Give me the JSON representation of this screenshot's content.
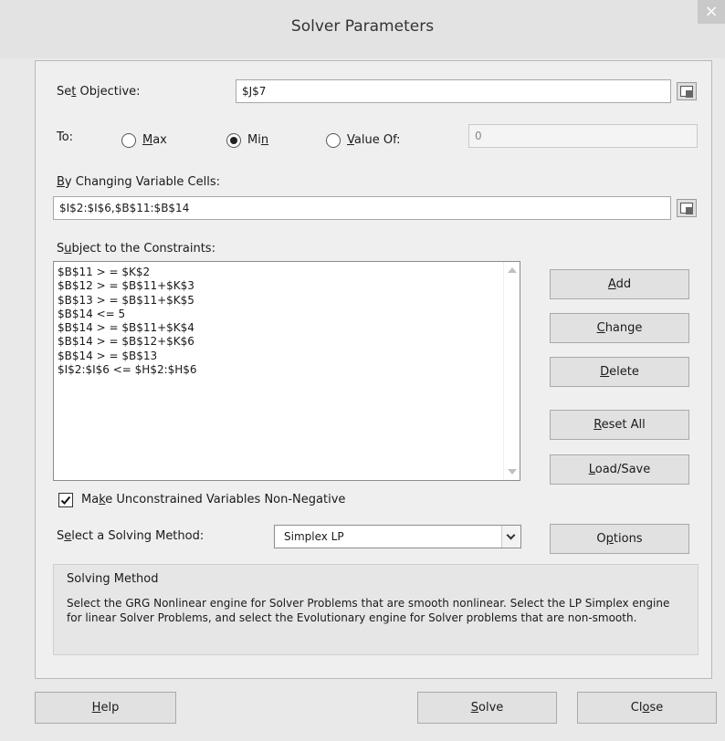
{
  "window": {
    "title": "Solver Parameters",
    "close_glyph": "×"
  },
  "objective": {
    "label_pre": "Se",
    "label_u": "t",
    "label_post": " Objective:",
    "value": "$J$7"
  },
  "to": {
    "label": "To:",
    "max": {
      "pre": "",
      "u": "M",
      "post": "ax",
      "selected": false
    },
    "min": {
      "pre": "Mi",
      "u": "n",
      "post": "",
      "selected": true
    },
    "value_of": {
      "pre": "",
      "u": "V",
      "post": "alue Of:",
      "selected": false,
      "value": "0"
    }
  },
  "changing_cells": {
    "label_u": "B",
    "label_post": "y Changing Variable Cells:",
    "value": "$I$2:$I$6,$B$11:$B$14"
  },
  "constraints": {
    "label_pre": "S",
    "label_u": "u",
    "label_post": "bject to the Constraints:",
    "items": [
      "$B$11 > = $K$2",
      "$B$12 > = $B$11+$K$3",
      "$B$13 > = $B$11+$K$5",
      "$B$14 <= 5",
      "$B$14 > = $B$11+$K$4",
      "$B$14 > = $B$12+$K$6",
      "$B$14 > = $B$13",
      "$I$2:$I$6 <= $H$2:$H$6"
    ]
  },
  "side_buttons": {
    "add": {
      "u": "A",
      "post": "dd"
    },
    "change": {
      "u": "C",
      "post": "hange"
    },
    "delete": {
      "u": "D",
      "post": "elete"
    },
    "reset": {
      "u": "R",
      "post": "eset All"
    },
    "loadsave": {
      "u": "L",
      "post": "oad/Save"
    }
  },
  "non_negative": {
    "checked": true,
    "pre": "Ma",
    "u": "k",
    "post": "e Unconstrained Variables Non-Negative"
  },
  "method_select": {
    "label_pre": "S",
    "label_u": "e",
    "label_post": "lect a Solving Method:",
    "value": "Simplex LP"
  },
  "options_button": {
    "pre": "O",
    "u": "p",
    "post": "tions"
  },
  "solving_method": {
    "title": "Solving Method",
    "description": "Select the GRG Nonlinear engine for Solver Problems that are smooth nonlinear. Select the LP Simplex engine for linear Solver Problems, and select the Evolutionary engine for Solver problems that are non-smooth."
  },
  "bottom_buttons": {
    "help": {
      "u": "H",
      "post": "elp"
    },
    "solve": {
      "u": "S",
      "post": "olve"
    },
    "close": {
      "pre": "Cl",
      "u": "o",
      "post": "se"
    }
  }
}
